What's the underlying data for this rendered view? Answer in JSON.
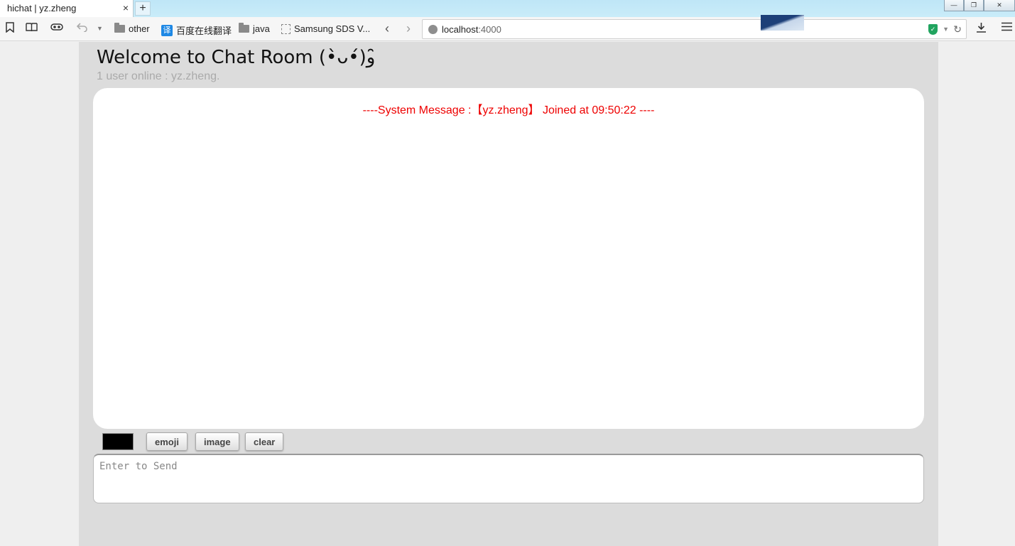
{
  "browser": {
    "tab_title": "hichat | yz.zheng",
    "tab_close": "×",
    "new_tab": "+",
    "bookmarks": [
      {
        "label": "other",
        "icon": "folder-icon"
      },
      {
        "label": "百度在线翻译",
        "icon": "translate-icon"
      },
      {
        "label": "java",
        "icon": "folder-icon"
      },
      {
        "label": "Samsung SDS V...",
        "icon": "page-icon"
      }
    ],
    "translate_glyph": "译",
    "url_host": "localhost",
    "url_port": ":4000",
    "back_arrow": "‹",
    "forward_arrow": "›",
    "win_min": "—",
    "win_max": "❐",
    "win_close": "✕"
  },
  "chat": {
    "title": "Welcome to Chat Room (•̀ᴗ•́)و ̑̑",
    "status": "1 user online : yz.zheng.",
    "messages": [
      {
        "type": "system",
        "text": "----System Message :【yz.zheng】 Joined at 09:50:22 ----",
        "color": "#e00000"
      }
    ],
    "color_picker_value": "#000000",
    "buttons": {
      "emoji": "emoji",
      "image": "image",
      "clear": "clear"
    },
    "input_placeholder": "Enter to Send"
  }
}
